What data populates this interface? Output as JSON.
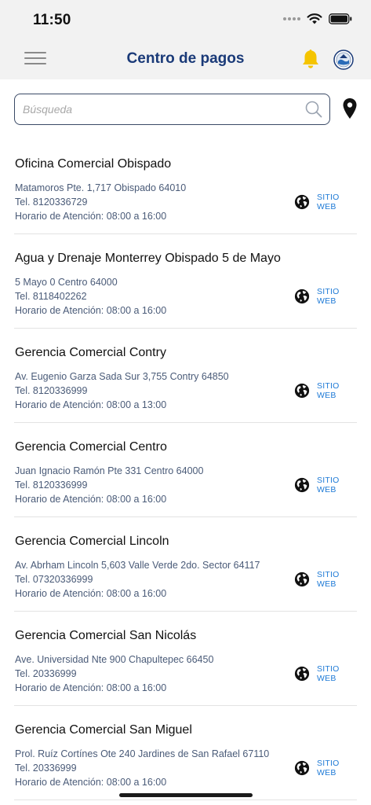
{
  "status_bar": {
    "time": "11:50"
  },
  "nav": {
    "title": "Centro de pagos",
    "menu_icon": "hamburger-icon",
    "bell_icon": "bell-icon",
    "bell_color": "#f5c400",
    "logo_icon": "agua-drenaje-logo-icon"
  },
  "search": {
    "placeholder": "Búsqueda",
    "value": ""
  },
  "colors": {
    "title": "#1a3a78",
    "link": "#1e7ad6",
    "detail_text": "#4a5b78",
    "divider": "#e3e3e3"
  },
  "offices": [
    {
      "name": "Oficina Comercial Obispado",
      "address": "Matamoros Pte. 1,717  Obispado 64010",
      "tel": "Tel. 8120336729",
      "hours": "Horario de Atención: 08:00 a 16:00",
      "link_label": "SITIO WEB"
    },
    {
      "name": "Agua y Drenaje Monterrey Obispado 5 de Mayo",
      "address": "5 Mayo 0  Centro 64000",
      "tel": "Tel. 8118402262",
      "hours": "Horario de Atención: 08:00 a 16:00",
      "link_label": "SITIO WEB"
    },
    {
      "name": "Gerencia Comercial Contry",
      "address": "Av. Eugenio Garza Sada Sur 3,755  Contry 64850",
      "tel": "Tel. 8120336999",
      "hours": "Horario de Atención: 08:00 a 13:00",
      "link_label": "SITIO WEB"
    },
    {
      "name": "Gerencia Comercial Centro",
      "address": "Juan Ignacio Ramón Pte 331  Centro 64000",
      "tel": "Tel. 8120336999",
      "hours": "Horario de Atención: 08:00 a 16:00",
      "link_label": "SITIO WEB"
    },
    {
      "name": "Gerencia Comercial Lincoln",
      "address": "Av. Abrham Lincoln 5,603  Valle Verde 2do. Sector 64117",
      "tel": "Tel. 07320336999",
      "hours": "Horario de Atención: 08:00 a 16:00",
      "link_label": "SITIO WEB"
    },
    {
      "name": "Gerencia Comercial San Nicolás",
      "address": "Ave. Universidad Nte 900  Chapultepec 66450",
      "tel": "Tel. 20336999",
      "hours": "Horario de Atención: 08:00 a 16:00",
      "link_label": "SITIO WEB"
    },
    {
      "name": "Gerencia Comercial San Miguel",
      "address": "Prol. Ruíz Cortínes Ote 240  Jardines de San Rafael 67110",
      "tel": "Tel. 20336999",
      "hours": "Horario de Atención: 08:00 a 16:00",
      "link_label": "SITIO WEB"
    }
  ]
}
